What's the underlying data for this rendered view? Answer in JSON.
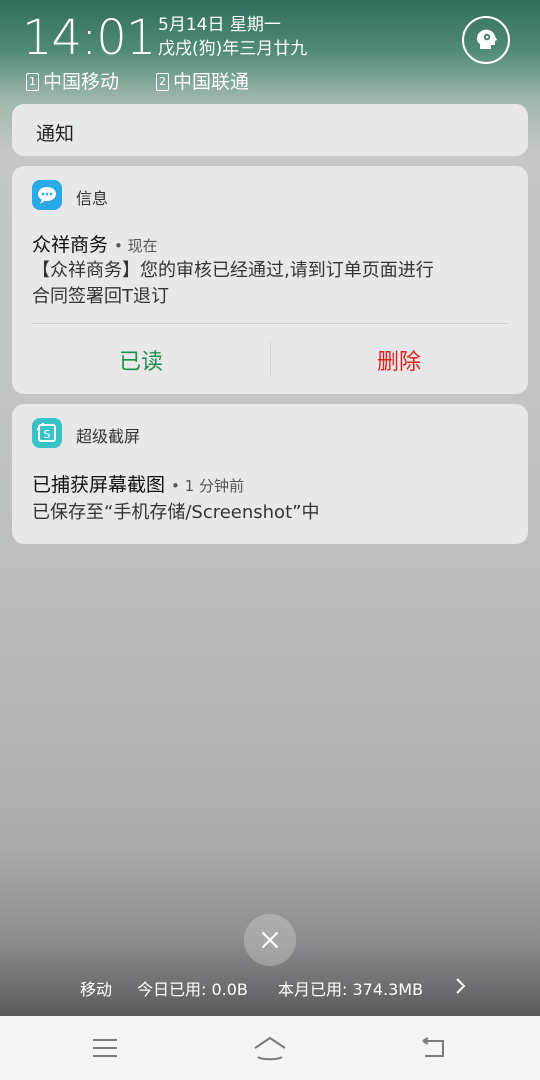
{
  "status": {
    "time": "14:01",
    "date_line1": "5月14日 星期一",
    "date_line2": "戊戌(狗)年三月廿九",
    "sim1_index": "1",
    "sim1_carrier": "中国移动",
    "sim2_index": "2",
    "sim2_carrier": "中国联通"
  },
  "notification_header": {
    "label": "通知"
  },
  "message_notification": {
    "app_name": "信息",
    "sender": "众祥商务",
    "time": "• 现在",
    "body_line1": "【众祥商务】您的审核已经通过,请到订单页面进行",
    "body_line2": "合同签署回T退订",
    "read_label": "已读",
    "delete_label": "删除",
    "app_icon_color": "#29a9e8",
    "read_color": "#1e9050",
    "delete_color": "#e02020"
  },
  "screenshot_notification": {
    "app_name": "超级截屏",
    "title": "已捕获屏幕截图",
    "time": "• 1 分钟前",
    "body": "已保存至“手机存储/Screenshot”中",
    "app_icon_color": "#39c3c9"
  },
  "data_usage": {
    "carrier": "移动",
    "today_label": "今日已用: 0.0B",
    "month_label": "本月已用: 374.3MB"
  },
  "navigation": {
    "menu_icon": "menu-icon",
    "home_icon": "home-icon",
    "back_icon": "back-icon"
  }
}
